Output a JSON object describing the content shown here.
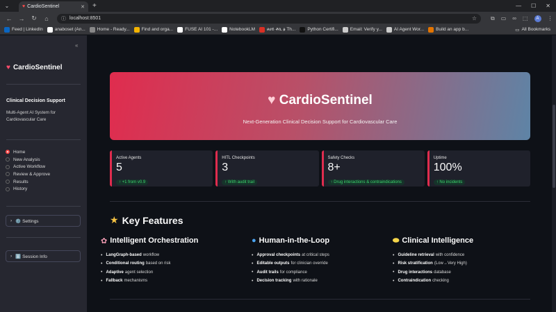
{
  "browser": {
    "tab_title": "CardioSentinel",
    "url": "localhost:8501",
    "profile_initial": "A",
    "bookmarks": [
      {
        "label": "Feed | LinkedIn",
        "color": "#0a66c2"
      },
      {
        "label": "anaboset (An...",
        "color": "#ffffff"
      },
      {
        "label": "Home - Ready...",
        "color": "#888888"
      },
      {
        "label": "Find and orga...",
        "color": "#f4b400"
      },
      {
        "label": "FUSE AI 101 -...",
        "color": "#ffffff"
      },
      {
        "label": "NotebookLM",
        "color": "#ffffff"
      },
      {
        "label": "ፀሀይ ቶኪ ፅ Th...",
        "color": "#d93025"
      },
      {
        "label": "Python Certifi...",
        "color": "#111111"
      },
      {
        "label": "Email: Verify y...",
        "color": "#cccccc"
      },
      {
        "label": "AI Agent Wor...",
        "color": "#cccccc"
      },
      {
        "label": "Build an app b...",
        "color": "#e37400"
      }
    ],
    "all_bookmarks": "All Bookmarks"
  },
  "sidebar": {
    "title": "CardioSentinel",
    "subtitle": "Clinical Decision Support",
    "description": "Multi-Agent AI System for Cardiovascular Care",
    "nav": [
      "Home",
      "New Analysis",
      "Active Workflow",
      "Review & Approve",
      "Results",
      "History"
    ],
    "selected_index": 0,
    "settings_label": "⚙️ Settings",
    "session_label": "ℹ️ Session Info"
  },
  "hero": {
    "title": "CardioSentinel",
    "subtitle": "Next-Generation Clinical Decision Support for Cardiovascular Care"
  },
  "metrics": [
    {
      "label": "Active Agents",
      "value": "5",
      "delta": "↑ +1 from v0.9"
    },
    {
      "label": "HITL Checkpoints",
      "value": "3",
      "delta": "↑ With audit trail"
    },
    {
      "label": "Safety Checks",
      "value": "8+",
      "delta": "↑ Drug interactions & contraindications"
    },
    {
      "label": "Uptime",
      "value": "100%",
      "delta": "↑ No incidents"
    }
  ],
  "key_features": {
    "title": "Key Features",
    "columns": [
      {
        "heading": "Intelligent Orchestration",
        "icon": "brain-icon",
        "items": [
          {
            "bold": "LangGraph-based",
            "rest": "workflow"
          },
          {
            "bold": "Conditional routing",
            "rest": "based on risk"
          },
          {
            "bold": "Adaptive",
            "rest": "agent selection"
          },
          {
            "bold": "Fallback",
            "rest": "mechanisms"
          }
        ]
      },
      {
        "heading": "Human-in-the-Loop",
        "icon": "person-icon",
        "items": [
          {
            "bold": "Approval checkpoints",
            "rest": "at critical steps"
          },
          {
            "bold": "Editable outputs",
            "rest": "for clinician override"
          },
          {
            "bold": "Audit trails",
            "rest": "for compliance"
          },
          {
            "bold": "Decision tracking",
            "rest": "with rationale"
          }
        ]
      },
      {
        "heading": "Clinical Intelligence",
        "icon": "pill-icon",
        "items": [
          {
            "bold": "Guideline retrieval",
            "rest": "with confidence"
          },
          {
            "bold": "Risk stratification",
            "rest": "(Low→Very High)"
          },
          {
            "bold": "Drug interactions",
            "rest": "database"
          },
          {
            "bold": "Contraindication",
            "rest": "checking"
          }
        ]
      }
    ]
  },
  "colors": {
    "accent": "#ff4b4b",
    "hero_start": "#e02c4e",
    "hero_end": "#5e84a6",
    "delta_green": "#3dd56d"
  }
}
